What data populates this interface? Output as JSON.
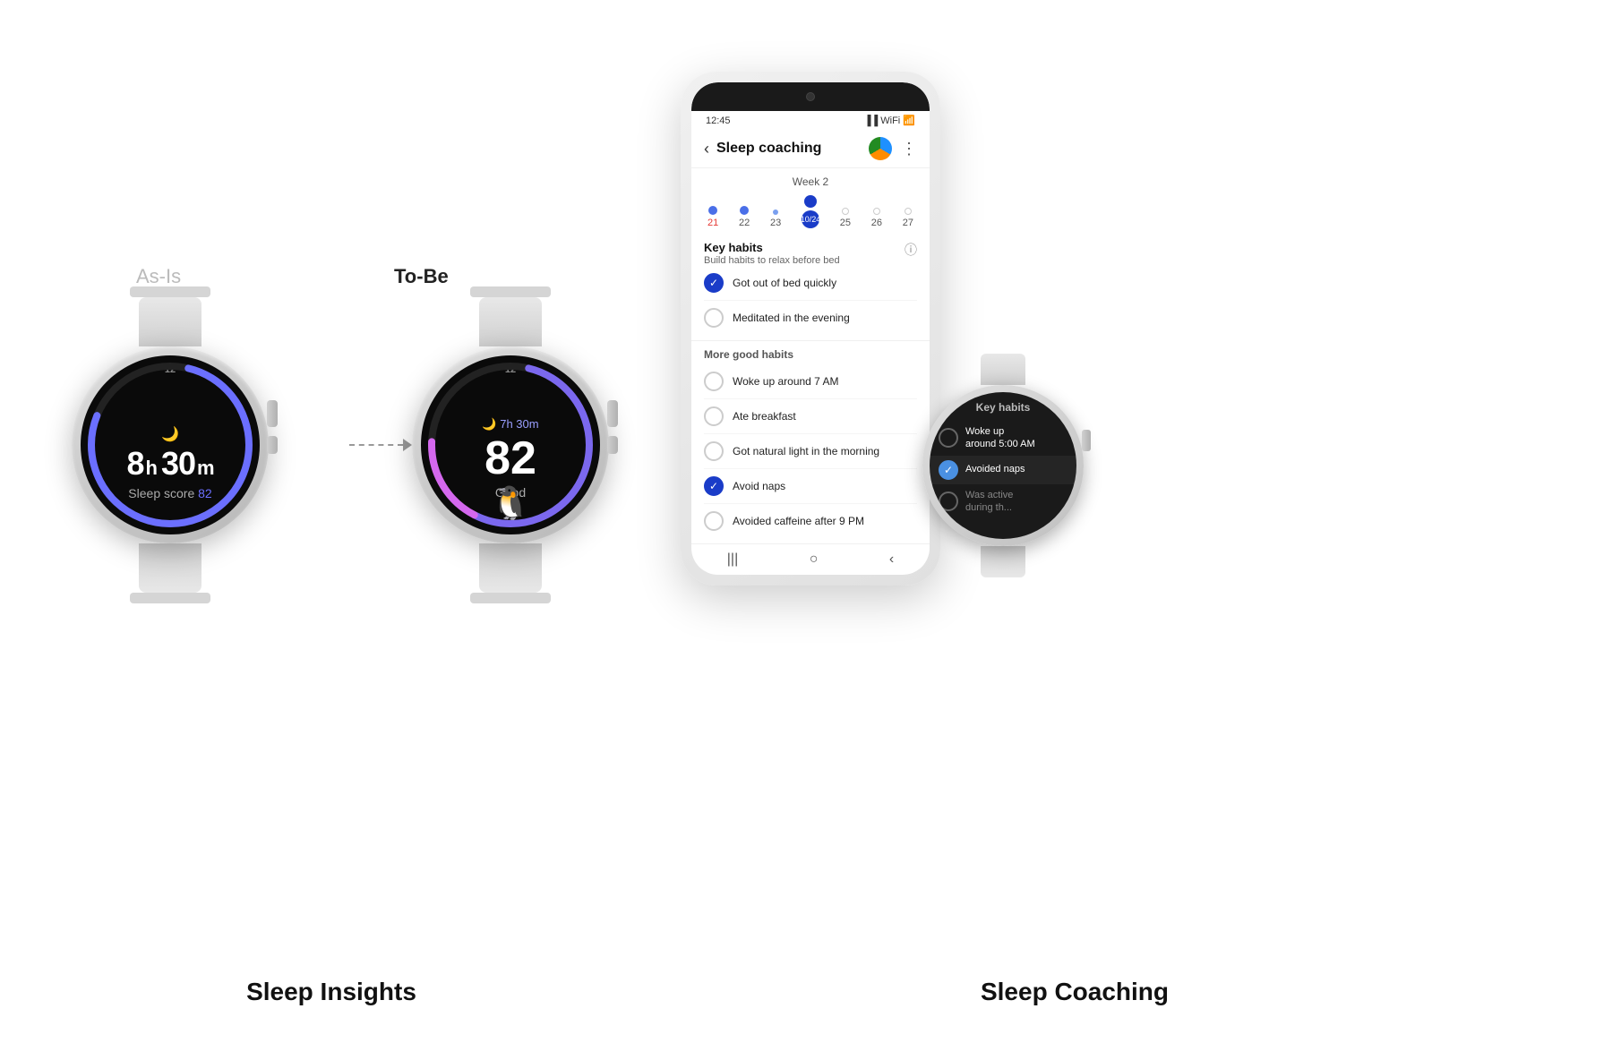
{
  "labels": {
    "asis": "As-Is",
    "tobe": "To-Be",
    "sleep_insights": "Sleep Insights",
    "sleep_coaching": "Sleep Coaching"
  },
  "watch1": {
    "twelve": "12",
    "time": "8h 30m",
    "time_h": "8",
    "time_m": "30",
    "time_unit_h": "h",
    "time_unit_m": "m",
    "score_label": "Sleep score",
    "score_value": "82"
  },
  "watch2": {
    "twelve": "12",
    "time_small": "7h 30m",
    "score": "82",
    "good": "Good"
  },
  "phone": {
    "status_time": "12:45",
    "title": "Sleep coaching",
    "week_label": "Week 2",
    "days": [
      {
        "num": "21",
        "red": true,
        "dot_size": "medium"
      },
      {
        "num": "22",
        "red": false,
        "dot_size": "medium"
      },
      {
        "num": "23",
        "red": false,
        "dot_size": "small"
      },
      {
        "num": "10/24",
        "red": false,
        "dot_size": "large",
        "selected": true
      },
      {
        "num": "25",
        "red": false,
        "dot_size": "empty"
      },
      {
        "num": "26",
        "red": false,
        "dot_size": "empty"
      },
      {
        "num": "27",
        "red": false,
        "dot_size": "empty"
      }
    ],
    "key_habits": {
      "title": "Key habits",
      "subtitle": "Build habits to relax before bed",
      "items": [
        {
          "text": "Got out of bed quickly",
          "checked": true
        },
        {
          "text": "Meditated in the evening",
          "checked": false
        }
      ]
    },
    "more_habits": {
      "title": "More good habits",
      "items": [
        {
          "text": "Woke up around 7 AM",
          "checked": false
        },
        {
          "text": "Ate breakfast",
          "checked": false
        },
        {
          "text": "Got natural light in the morning",
          "checked": false
        },
        {
          "text": "Avoid naps",
          "checked": true
        },
        {
          "text": "Avoided caffeine after 9 PM",
          "checked": false
        }
      ]
    }
  },
  "small_watch": {
    "title": "Key habits",
    "items": [
      {
        "text": "Woke up\naround 5:00 AM",
        "checked": false
      },
      {
        "text": "Avoided naps",
        "checked": true
      },
      {
        "text": "Was active\nduring th...",
        "checked": false,
        "partial": true
      }
    ]
  }
}
